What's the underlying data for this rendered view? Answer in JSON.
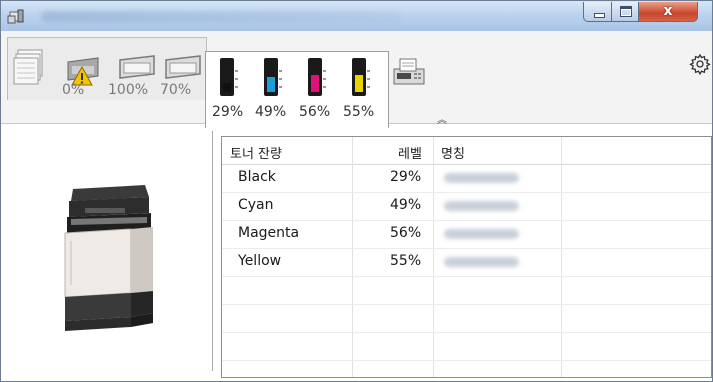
{
  "window": {
    "title_visible": false,
    "controls": {
      "minimize": "minimize",
      "maximize": "maximize",
      "close_label": "x"
    }
  },
  "paper_status": {
    "percentages": [
      "0%",
      "100%",
      "70%"
    ],
    "warning": true
  },
  "toner_panel": {
    "percentages": [
      "29%",
      "49%",
      "56%",
      "55%"
    ],
    "colors": [
      "#111111",
      "#1e9ed8",
      "#e0127a",
      "#e8d400"
    ],
    "levels": [
      0.29,
      0.49,
      0.56,
      0.55
    ]
  },
  "icons": {
    "app": "printer-status-app-icon",
    "settings": "gear-icon",
    "collapse": "chevron-up-icon",
    "fax": "fax-icon"
  },
  "table": {
    "headers": [
      "토너 잔량",
      "레벨",
      "명칭"
    ],
    "rows": [
      {
        "name": "Black",
        "level": "29%"
      },
      {
        "name": "Cyan",
        "level": "49%"
      },
      {
        "name": "Magenta",
        "level": "56%"
      },
      {
        "name": "Yellow",
        "level": "55%"
      }
    ]
  }
}
